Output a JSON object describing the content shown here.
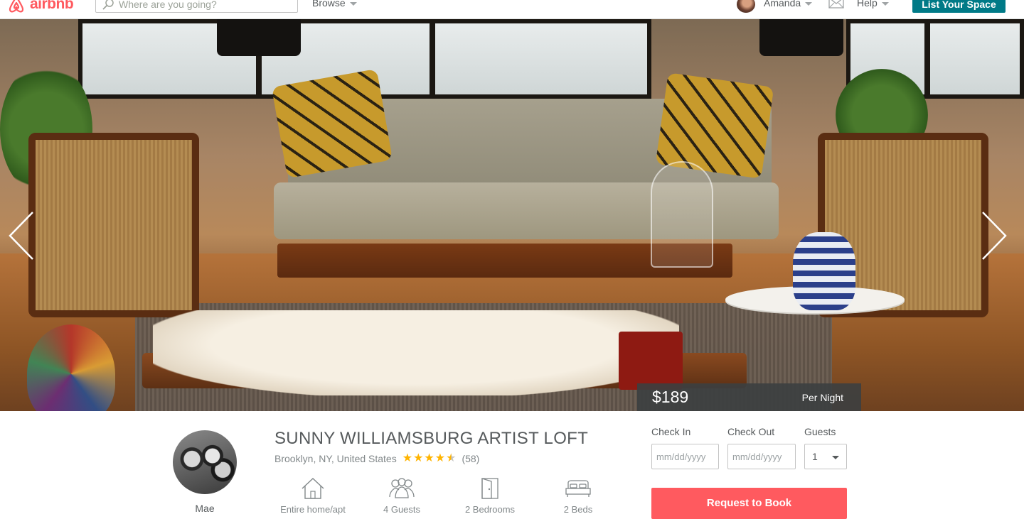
{
  "header": {
    "logo_text": "airbnb",
    "search_placeholder": "Where are you going?",
    "browse_label": "Browse",
    "user_name": "Amanda",
    "help_label": "Help",
    "list_space_label": "List Your Space"
  },
  "listing": {
    "price": "$189",
    "per_night": "Per Night",
    "host_name": "Mae",
    "title": "SUNNY WILLIAMSBURG ARTIST LOFT",
    "location": "Brooklyn, NY, United States",
    "rating": 4.5,
    "review_count": "(58)",
    "amenities": [
      {
        "icon": "house-icon",
        "label": "Entire home/apt"
      },
      {
        "icon": "guests-icon",
        "label": "4 Guests"
      },
      {
        "icon": "door-icon",
        "label": "2 Bedrooms"
      },
      {
        "icon": "bed-icon",
        "label": "2 Beds"
      }
    ]
  },
  "booking": {
    "check_in_label": "Check In",
    "check_out_label": "Check Out",
    "guests_label": "Guests",
    "date_placeholder": "mm/dd/yyyy",
    "guests_value": "1",
    "request_label": "Request to Book"
  },
  "colors": {
    "brand": "#ff5a5f",
    "teal": "#007a87",
    "star": "#ffb400"
  }
}
